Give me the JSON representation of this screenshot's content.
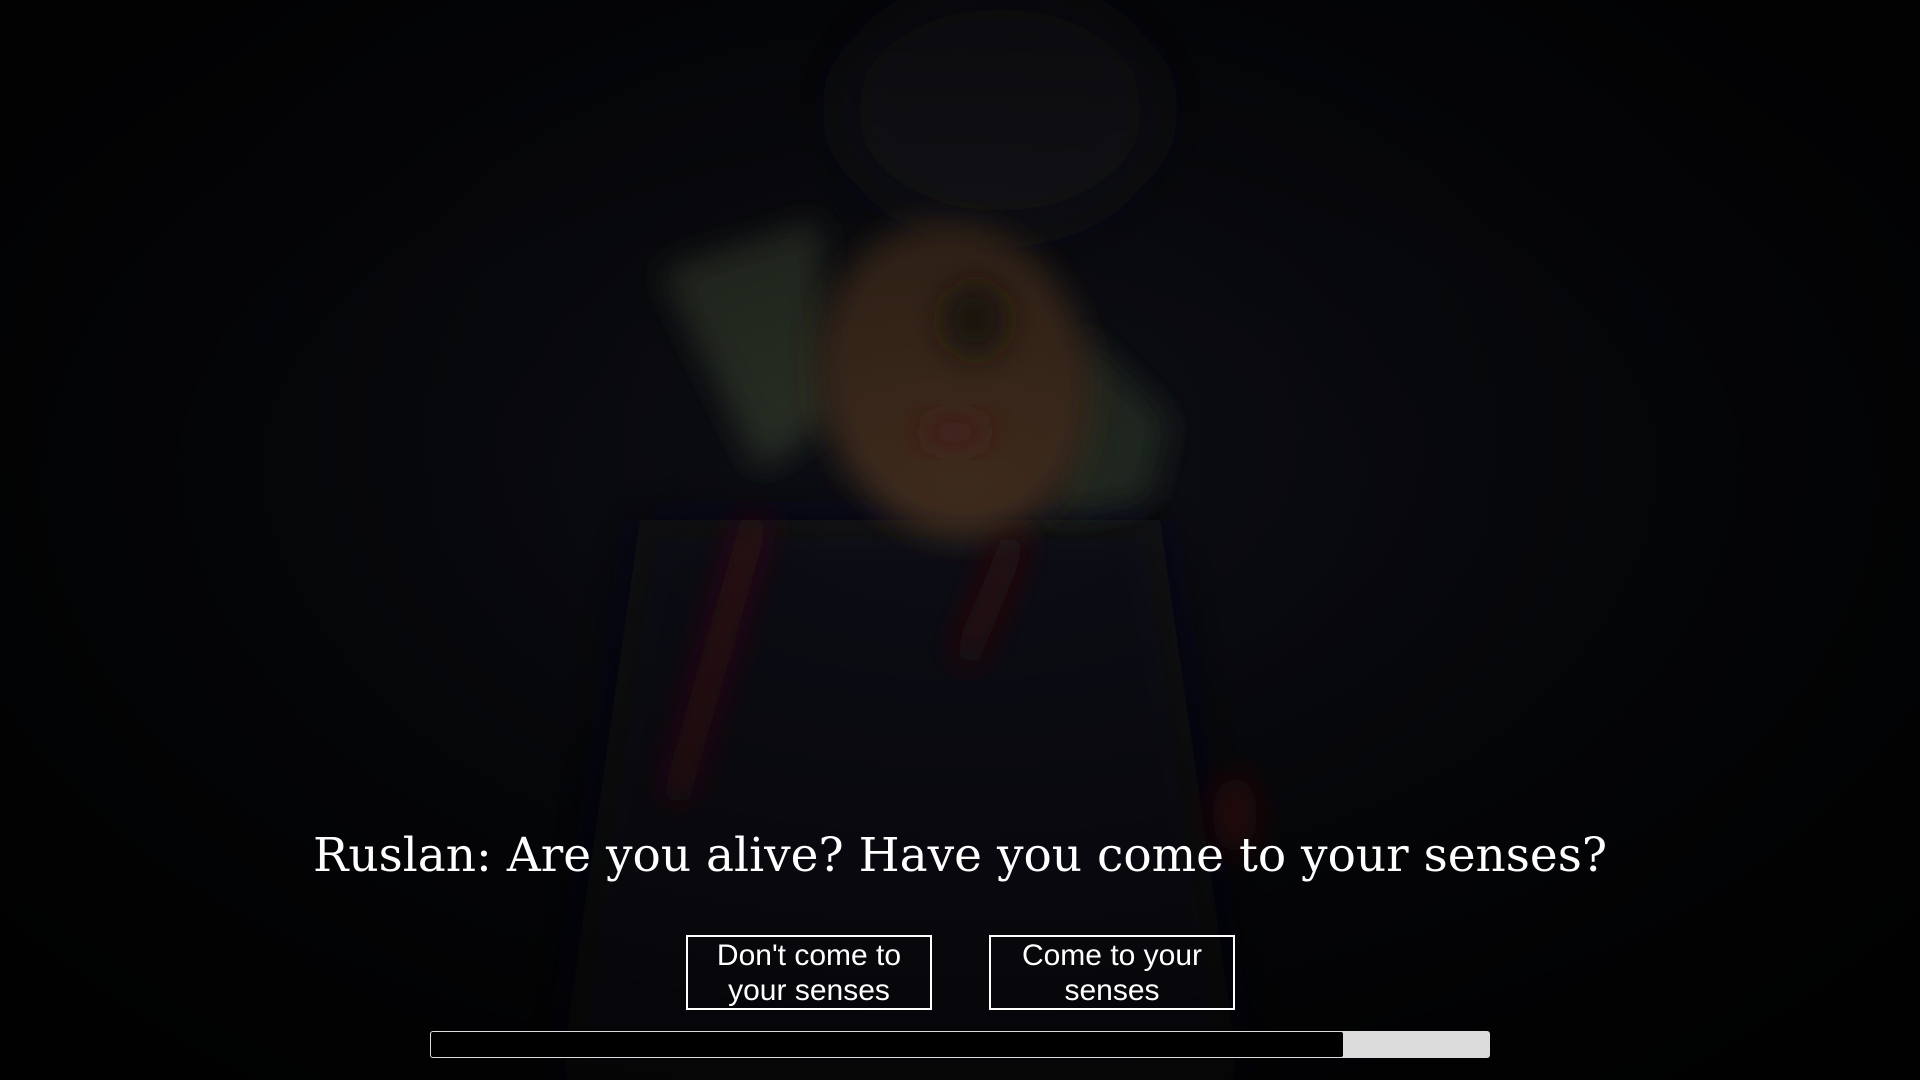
{
  "dialogue": {
    "speaker": "Ruslan",
    "line": "Ruslan: Are you alive? Have you come to your senses?"
  },
  "choices": [
    {
      "label": "Don't come to your senses"
    },
    {
      "label": "Come to your senses"
    }
  ],
  "timer": {
    "elapsed_fraction": 0.86
  },
  "colors": {
    "text": "#ffffff",
    "timer_track": "#dcdcdc",
    "timer_fill": "#000000",
    "background": "#050507"
  },
  "icons": {
    "background": "blurred-character-portrait"
  }
}
